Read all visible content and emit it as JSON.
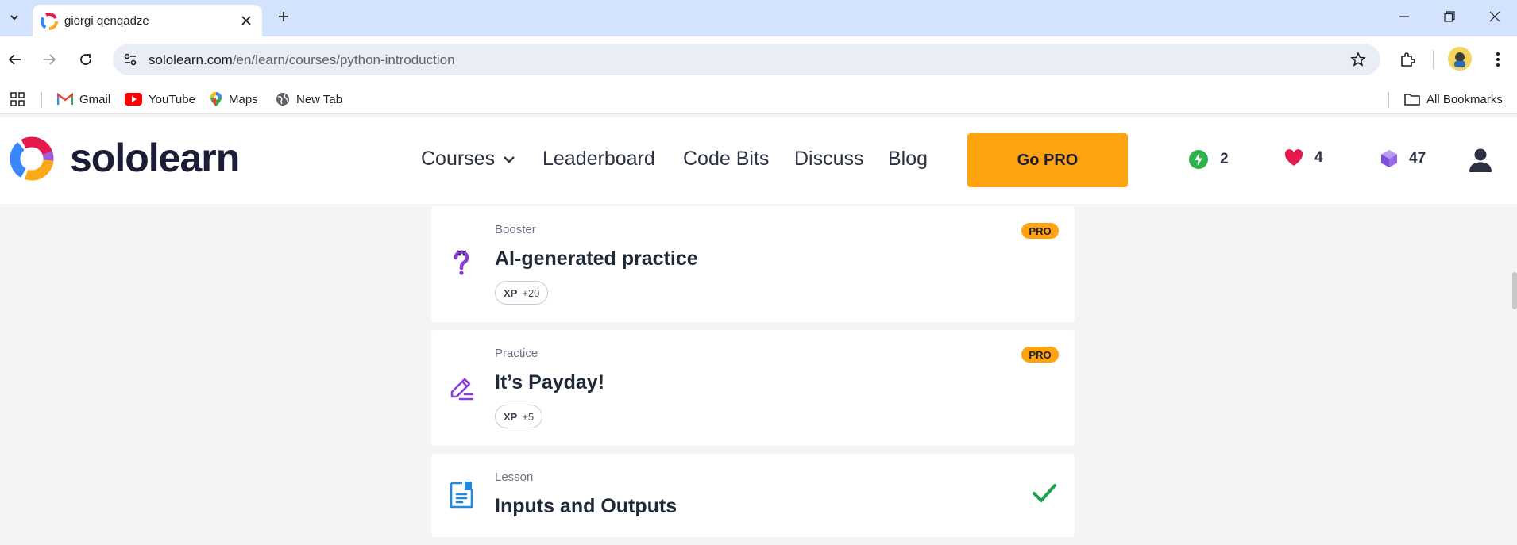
{
  "browser": {
    "tab_title": "giorgi qenqadze",
    "url_host": "sololearn.com",
    "url_path": "/en/learn/courses/python-introduction",
    "bookmarks": [
      "Gmail",
      "YouTube",
      "Maps",
      "New Tab"
    ],
    "all_bookmarks": "All Bookmarks"
  },
  "header": {
    "logo_text": "sololearn",
    "nav": [
      "Courses",
      "Leaderboard",
      "Code Bits",
      "Discuss",
      "Blog"
    ],
    "gopro_label": "Go PRO",
    "streak": "2",
    "hearts": "4",
    "gems": "47"
  },
  "colors": {
    "accent": "#ffa310",
    "purple_icon": "#8b3dd9",
    "blue_icon": "#1e88e5",
    "check_green": "#1aa34a",
    "streak_green": "#2eb24a",
    "heart_red": "#e5194b"
  },
  "cards": [
    {
      "type": "Booster",
      "title": "AI-generated practice",
      "xp_label": "XP",
      "xp_value": "+20",
      "badge": "PRO",
      "icon": "question-mark-icon"
    },
    {
      "type": "Practice",
      "title": "It’s Payday!",
      "xp_label": "XP",
      "xp_value": "+5",
      "badge": "PRO",
      "icon": "pencil-icon"
    },
    {
      "type": "Lesson",
      "title": "Inputs and Outputs",
      "status": "completed",
      "icon": "document-icon"
    }
  ]
}
